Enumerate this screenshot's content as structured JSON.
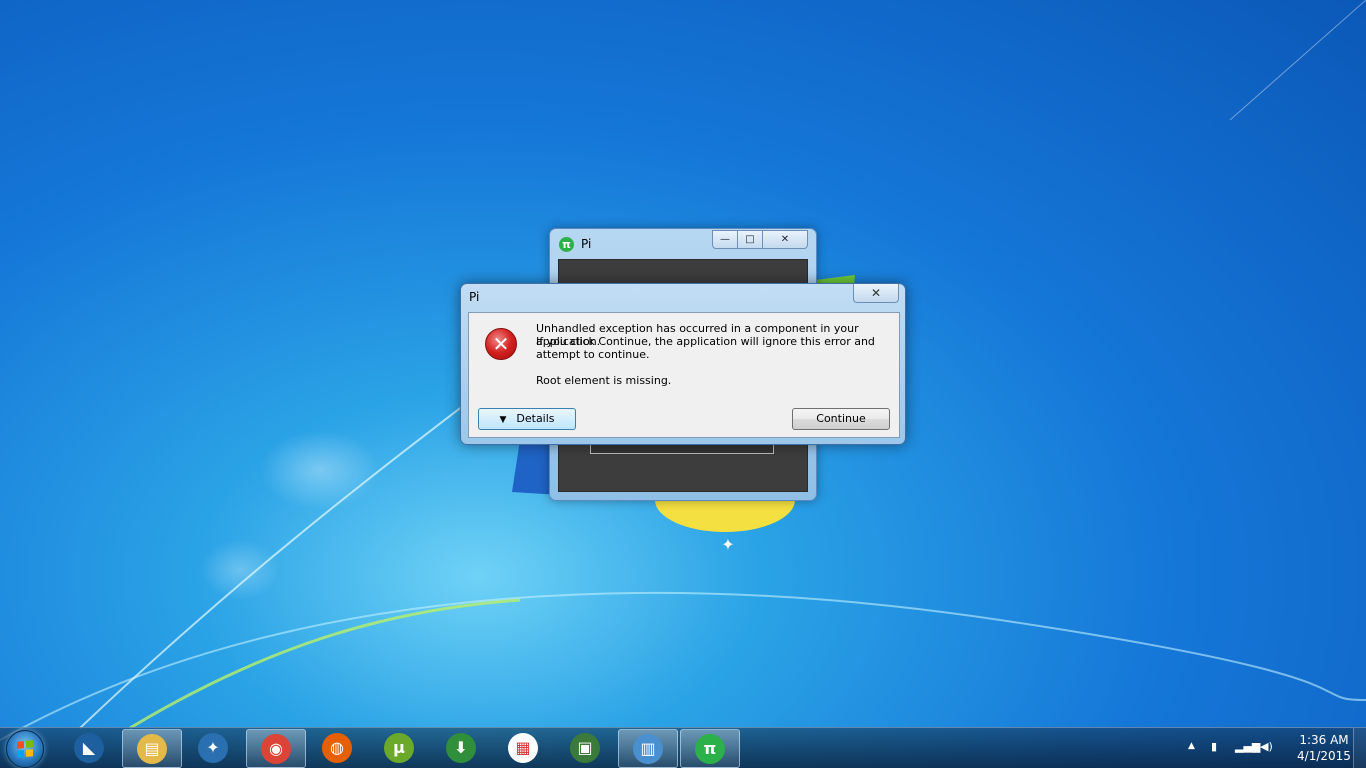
{
  "background_window": {
    "title": "Pi",
    "title_icon_glyph": "π",
    "minimize_glyph": "—",
    "maximize_glyph": "□",
    "close_glyph": "✕"
  },
  "dialog": {
    "title": "Pi",
    "close_glyph": "✕",
    "icon": "error-x-icon",
    "message_line1": "Unhandled exception has occurred in a component in your application.",
    "message_line2": "If you click Continue, the application will ignore this error and attempt to continue.",
    "message_line3": "Root element is missing.",
    "details_button": "Details",
    "continue_button": "Continue"
  },
  "taskbar": {
    "pinned": [
      {
        "name": "desktop-app-icon",
        "color": "#1e5fa0",
        "glyph": "◣",
        "active": false
      },
      {
        "name": "windows-explorer-icon",
        "color": "#e3b94a",
        "glyph": "▤",
        "active": true
      },
      {
        "name": "firstclarity-icon",
        "color": "#2a6fb0",
        "glyph": "✦",
        "active": false
      },
      {
        "name": "chrome-icon",
        "color": "#db4437",
        "glyph": "◉",
        "active": true
      },
      {
        "name": "firefox-icon",
        "color": "#e66000",
        "glyph": "◍",
        "active": false
      },
      {
        "name": "utorrent-icon",
        "color": "#6aa92a",
        "glyph": "µ",
        "active": false
      },
      {
        "name": "internet-download-manager-icon",
        "color": "#2f8f3a",
        "glyph": "⬇",
        "active": false
      },
      {
        "name": "apps-grid-icon",
        "color": "#ffffff",
        "glyph": "▦",
        "active": false
      },
      {
        "name": "task-manager-icon",
        "color": "#3a7a3a",
        "glyph": "▣",
        "active": false
      },
      {
        "name": "control-panel-icon",
        "color": "#4a90d0",
        "glyph": "▥",
        "active": true
      },
      {
        "name": "pi-app-icon",
        "color": "#2bb04a",
        "glyph": "π",
        "active": true
      }
    ],
    "tray_arrow": "▲",
    "clock_time": "1:36 AM",
    "clock_date": "4/1/2015"
  }
}
